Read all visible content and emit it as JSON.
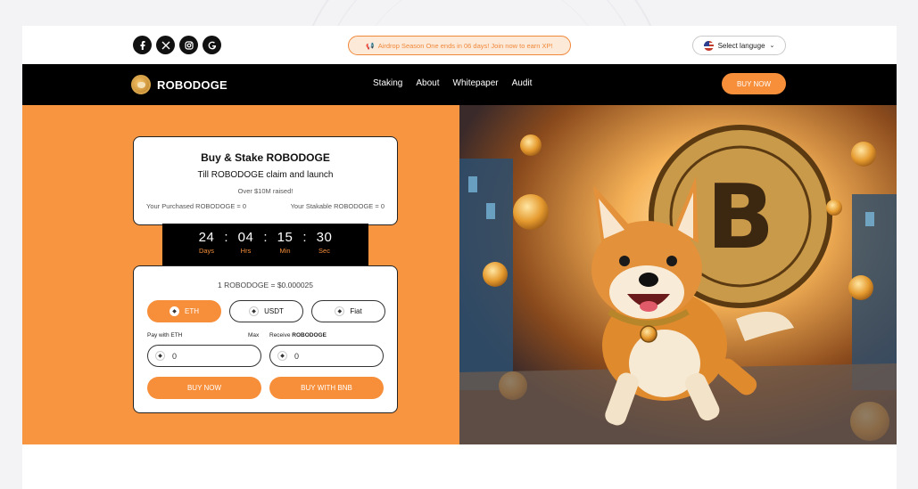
{
  "topbar": {
    "socials": [
      {
        "name": "facebook-icon",
        "glyph": "f"
      },
      {
        "name": "x-twitter-icon",
        "glyph": "𝕏"
      },
      {
        "name": "instagram-icon",
        "glyph": ""
      },
      {
        "name": "google-icon",
        "glyph": "G"
      }
    ],
    "announcement": "Airdrop Season One ends in 06 days! Join now to earn XP!",
    "language_label": "Select languge"
  },
  "nav": {
    "brand": "ROBODOGE",
    "links": [
      "Staking",
      "About",
      "Whitepaper",
      "Audit"
    ],
    "buy_now": "BUY NOW"
  },
  "presale": {
    "title": "Buy & Stake ROBODOGE",
    "subtitle": "Till ROBODOGE claim and launch",
    "raised": "Over $10M raised!",
    "purchased": "Your Purchased ROBODOGE = 0",
    "stakable": "Your Stakable ROBODOGE = 0",
    "countdown": {
      "days": "24",
      "hrs": "04",
      "min": "15",
      "sec": "30",
      "days_label": "Days",
      "hrs_label": "Hrs",
      "min_label": "Min",
      "sec_label": "Sec"
    },
    "rate": "1 ROBODOGE = $0.000025",
    "pay_options": [
      "ETH",
      "USDT",
      "Fiat"
    ],
    "pay_with_label": "Pay with ETH",
    "max_label": "Max",
    "receive_label_prefix": "Receive",
    "receive_token": "ROBODOGE",
    "pay_amount": "0",
    "receive_amount": "0",
    "buy_button": "BUY NOW",
    "bnb_button": "BUY WITH BNB"
  },
  "colors": {
    "accent": "#f68e3a",
    "hero_bg": "#f89540",
    "nav_bg": "#000000"
  }
}
